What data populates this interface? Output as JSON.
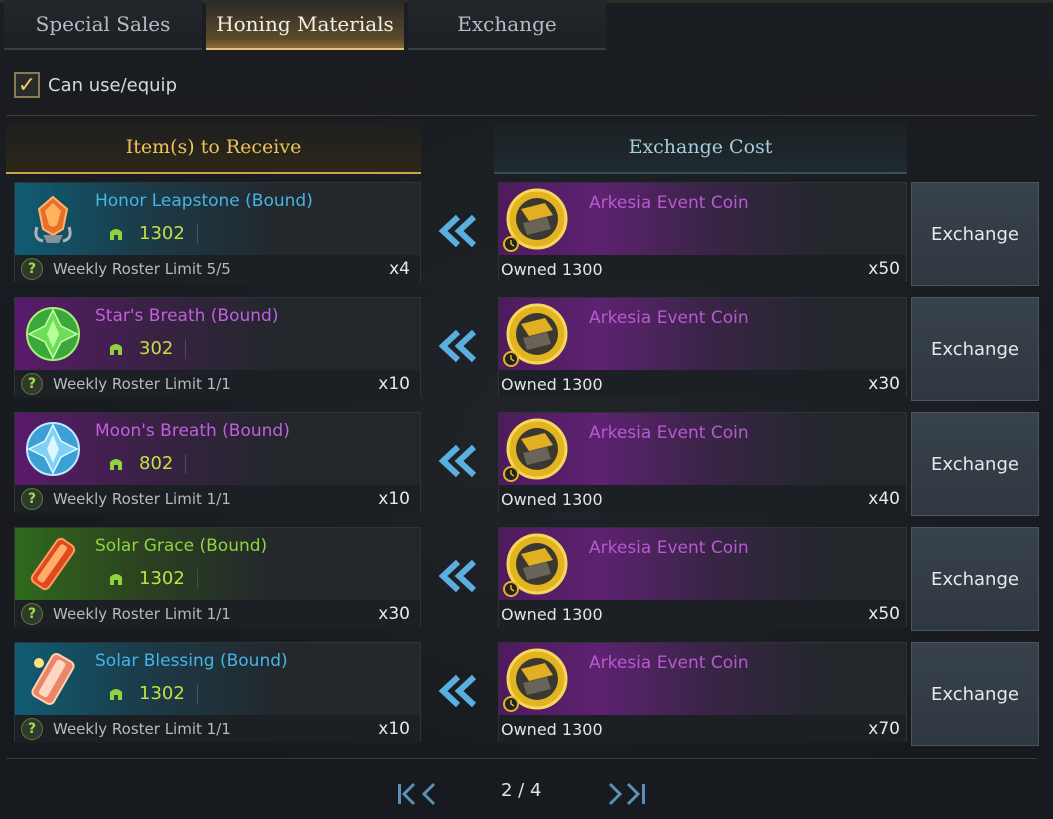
{
  "tabs": [
    {
      "label": "Special Sales",
      "active": false
    },
    {
      "label": "Honing Materials",
      "active": true
    },
    {
      "label": "Exchange",
      "active": false
    }
  ],
  "filter": {
    "label": "Can use/equip",
    "checked": true
  },
  "headers": {
    "receive": "Item(s) to Receive",
    "cost": "Exchange Cost"
  },
  "rows": [
    {
      "item_name": "Honor Leapstone (Bound)",
      "name_color": "blue",
      "item_level": "1302",
      "limit": "Weekly Roster Limit 5/5",
      "item_qty": "x4",
      "icon": "leapstone-icon",
      "cost_name": "Arkesia Event Coin",
      "owned": "Owned 1300",
      "cost_qty": "x50",
      "button": "Exchange"
    },
    {
      "item_name": "Star's Breath (Bound)",
      "name_color": "purple",
      "item_level": "302",
      "limit": "Weekly Roster Limit 1/1",
      "item_qty": "x10",
      "icon": "stars-breath-icon",
      "cost_name": "Arkesia Event Coin",
      "owned": "Owned 1300",
      "cost_qty": "x30",
      "button": "Exchange"
    },
    {
      "item_name": "Moon's Breath (Bound)",
      "name_color": "purple",
      "item_level": "802",
      "limit": "Weekly Roster Limit 1/1",
      "item_qty": "x10",
      "icon": "moons-breath-icon",
      "cost_name": "Arkesia Event Coin",
      "owned": "Owned 1300",
      "cost_qty": "x40",
      "button": "Exchange"
    },
    {
      "item_name": "Solar Grace (Bound)",
      "name_color": "green",
      "item_level": "1302",
      "limit": "Weekly Roster Limit 1/1",
      "item_qty": "x30",
      "icon": "solar-grace-icon",
      "cost_name": "Arkesia Event Coin",
      "owned": "Owned 1300",
      "cost_qty": "x50",
      "button": "Exchange"
    },
    {
      "item_name": "Solar Blessing (Bound)",
      "name_color": "blue",
      "item_level": "1302",
      "limit": "Weekly Roster Limit 1/1",
      "item_qty": "x10",
      "icon": "solar-blessing-icon",
      "cost_name": "Arkesia Event Coin",
      "owned": "Owned 1300",
      "cost_qty": "x70",
      "button": "Exchange"
    }
  ],
  "pagination": {
    "text": "2 / 4"
  },
  "colors": {
    "tab_active_border": "#e6c37a",
    "receive_header_text": "#eec35a",
    "cost_header_text": "#a6cdd8",
    "coin_name": "#b65ad2",
    "item_level": "#c2e044"
  }
}
